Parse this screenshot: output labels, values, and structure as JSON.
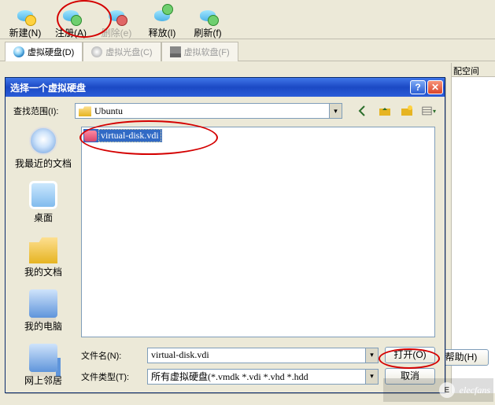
{
  "toolbar": {
    "items": [
      {
        "label": "新建(N)",
        "enabled": true
      },
      {
        "label": "注册(A)",
        "enabled": true
      },
      {
        "label": "删除(e)",
        "enabled": false
      },
      {
        "label": "释放(l)",
        "enabled": true
      },
      {
        "label": "刷新(f)",
        "enabled": true
      }
    ]
  },
  "tabs": {
    "items": [
      {
        "label": "虚拟硬盘(D)",
        "active": true
      },
      {
        "label": "虚拟光盘(C)",
        "active": false
      },
      {
        "label": "虚拟软盘(F)",
        "active": false
      }
    ]
  },
  "columns": {
    "header_right": "配空间"
  },
  "dialog": {
    "title": "选择一个虚拟硬盘",
    "lookin_label": "查找范围(I):",
    "lookin_value": "Ubuntu",
    "places": {
      "recent": "我最近的文档",
      "desktop": "桌面",
      "documents": "我的文档",
      "mycomputer": "我的电脑",
      "network": "网上邻居"
    },
    "file_list": {
      "items": [
        {
          "name": "virtual-disk.vdi",
          "selected": true
        }
      ]
    },
    "filename_label": "文件名(N):",
    "filename_value": "virtual-disk.vdi",
    "filetype_label": "文件类型(T):",
    "filetype_value": "所有虚拟硬盘(*.vmdk *.vdi *.vhd *.hdd",
    "open_button": "打开(O)",
    "cancel_button": "取消"
  },
  "misc": {
    "help_button": "帮助(H)",
    "watermark": "elecfans"
  }
}
